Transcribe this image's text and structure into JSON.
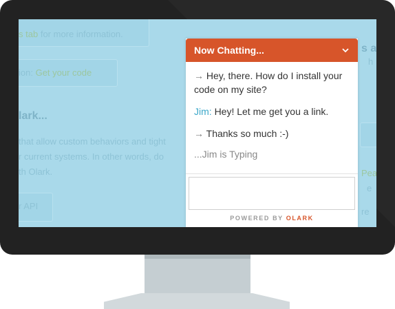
{
  "background_page": {
    "line1_prefix": "s",
    "line1_link": "tab",
    "line1_rest": "for more information.",
    "line2_prefix": "ion:",
    "line2_link": "Get your code",
    "heading": "lark...",
    "para1": "that allow custom behaviors and tight",
    "para2": "r current systems. In other words, do",
    "para3": "th Olark.",
    "button": "r API",
    "right1": "s a",
    "right2": "h",
    "right3": "Pea",
    "right4": "e",
    "right5": "re"
  },
  "chat": {
    "title": "Now Chatting...",
    "messages": [
      {
        "arrow": "→",
        "text": "Hey, there. How do I install your code on my site?"
      },
      {
        "sender": "Jim:",
        "text": "Hey! Let me get you a link."
      },
      {
        "arrow": "→",
        "text": "Thanks so much  :-)"
      }
    ],
    "typing": "...Jim is Typing",
    "powered_by": "POWERED BY",
    "brand": "OLARK"
  },
  "colors": {
    "accent": "#d7552a",
    "agent_name": "#3ba7c9",
    "screen_bg": "#a9d9ea"
  }
}
